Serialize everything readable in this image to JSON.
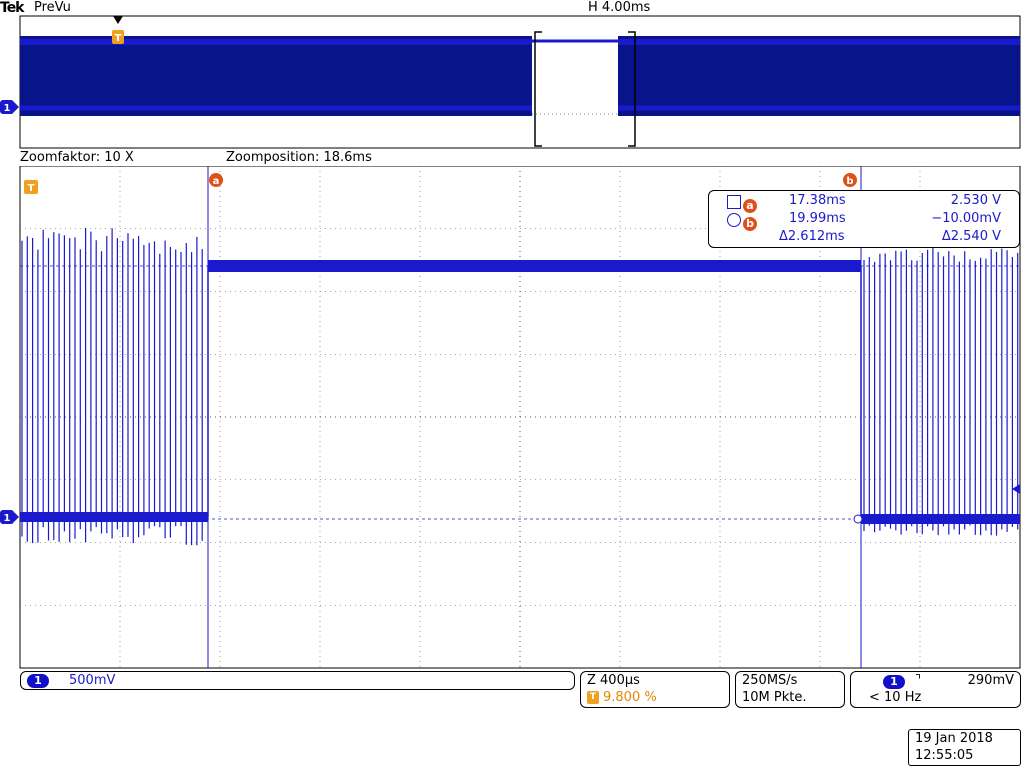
{
  "header": {
    "brand": "Tek",
    "mode": "PreVu",
    "horizontal": "H 4.00ms"
  },
  "zoom": {
    "factor_label": "Zoomfaktor: 10 X",
    "position_label": "Zoomposition: 18.6ms"
  },
  "markers": {
    "trigger": "T",
    "channel": "1",
    "cursor_a": "a",
    "cursor_b": "b"
  },
  "cursor_readout": {
    "a_time": "17.38ms",
    "a_value": "2.530 V",
    "b_time": "19.99ms",
    "b_value": "−10.00mV",
    "delta_time": "Δ2.612ms",
    "delta_value": "Δ2.540 V"
  },
  "status": {
    "channel_num": "1",
    "channel_scale": "500mV",
    "zoom_timebase": "Z 400µs",
    "trigger_pos": "9.800 %",
    "sample_rate": "250MS/s",
    "record_length": "10M Pkte.",
    "trigger_channel": "1",
    "trigger_slope": "⌝",
    "trigger_level": "290mV",
    "trigger_freq": "< 10 Hz",
    "date": "19 Jan  2018",
    "time": "12:55:05"
  },
  "colors": {
    "trace": "#1a1acc",
    "marker_orange": "#f0a020",
    "cursor_circle": "#e0501a",
    "trace_dark": "#08148a"
  }
}
